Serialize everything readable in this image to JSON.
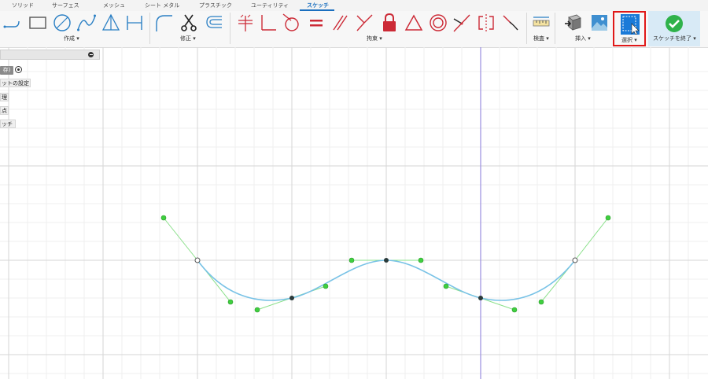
{
  "tabs": [
    {
      "label": "ソリッド",
      "active": false
    },
    {
      "label": "サーフェス",
      "active": false
    },
    {
      "label": "メッシュ",
      "active": false
    },
    {
      "label": "シート メタル",
      "active": false
    },
    {
      "label": "プラスチック",
      "active": false
    },
    {
      "label": "ユーティリティ",
      "active": false
    },
    {
      "label": "スケッチ",
      "active": true
    }
  ],
  "groups": {
    "create": "作成 ▾",
    "modify": "修正 ▾",
    "constraints": "拘束 ▾",
    "inspect": "検査 ▾",
    "insert": "挿入 ▾",
    "select": "選択 ▾",
    "finish": "スケッチを終了 ▾"
  },
  "browser": {
    "badge": "存)",
    "rows": [
      "ットの設定",
      "理",
      "点",
      "ッチ"
    ]
  },
  "icons": {
    "create": [
      "line-icon",
      "rectangle-icon",
      "circle-icon",
      "spline-icon",
      "triangle-fit-icon",
      "dimension-icon"
    ],
    "modify": [
      "fillet-icon",
      "trim-scissors-icon",
      "offset-icon"
    ],
    "constraints": [
      "fix-icon",
      "perpendicular-icon",
      "tangent-icon",
      "equal-icon",
      "parallel-icon",
      "angle-icon",
      "lock-icon",
      "triangle-icon",
      "concentric-icon",
      "midpoint-icon",
      "symmetry-icon",
      "smooth-icon"
    ],
    "inspect": [
      "measure-icon"
    ],
    "insert": [
      "insert-derive-icon",
      "insert-image-icon"
    ],
    "select": "select-window-icon",
    "finish": "finish-checkmark-icon"
  },
  "colors": {
    "accent": "#1a6fbf",
    "constraint_red": "#cc2a36",
    "highlight_border": "#e01818",
    "finish_green": "#2fb24a",
    "curve": "#78c2e6",
    "handle": "#3fcf3f"
  }
}
